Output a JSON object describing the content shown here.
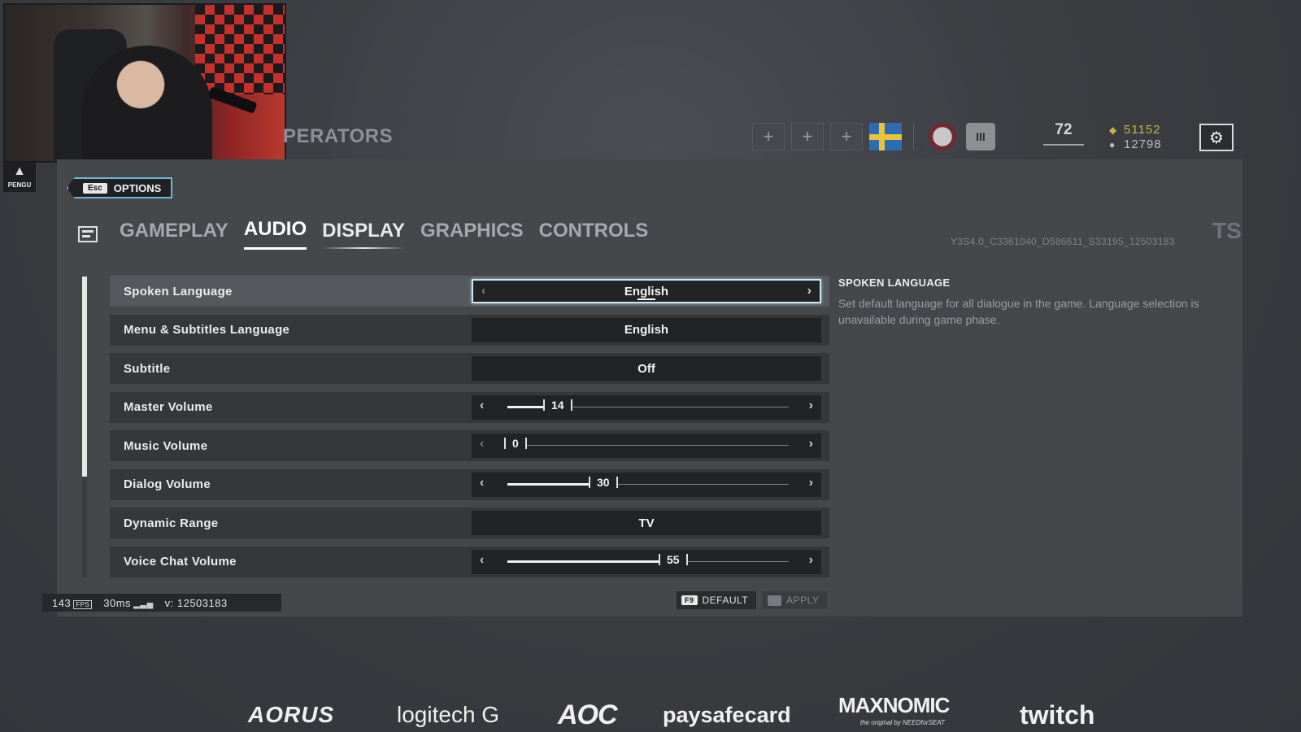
{
  "webcam": {
    "streamer_logo": "PENGU"
  },
  "header": {
    "partial_title": "PERATORS",
    "squad_slot_icon": "plus-icon",
    "level": "72",
    "renown": "51152",
    "credits": "12798",
    "settings_icon": "gear-icon"
  },
  "options": {
    "esc_key": "Esc",
    "label": "OPTIONS"
  },
  "tabs": [
    {
      "label": "GAMEPLAY"
    },
    {
      "label": "AUDIO"
    },
    {
      "label": "DISPLAY"
    },
    {
      "label": "GRAPHICS"
    },
    {
      "label": "CONTROLS"
    }
  ],
  "active_tab": "AUDIO",
  "ts_mark": "TS",
  "build_string": "Y3S4.0_C3361040_D586611_S33195_12503183",
  "settings": [
    {
      "label": "Spoken Language",
      "value": "English",
      "type": "select"
    },
    {
      "label": "Menu & Subtitles Language",
      "value": "English",
      "type": "select"
    },
    {
      "label": "Subtitle",
      "value": "Off",
      "type": "select"
    },
    {
      "label": "Master Volume",
      "value": "14",
      "type": "slider",
      "fill": 0.14
    },
    {
      "label": "Music Volume",
      "value": "0",
      "type": "slider",
      "fill": 0
    },
    {
      "label": "Dialog Volume",
      "value": "30",
      "type": "slider",
      "fill": 0.3
    },
    {
      "label": "Dynamic Range",
      "value": "TV",
      "type": "select"
    },
    {
      "label": "Voice Chat Volume",
      "value": "55",
      "type": "slider",
      "fill": 0.55
    }
  ],
  "description": {
    "title": "SPOKEN LANGUAGE",
    "text": "Set default language for all dialogue in the game. Language selection is unavailable during game phase."
  },
  "footer": {
    "default_key": "F9",
    "default_label": "DEFAULT",
    "apply_label": "APPLY"
  },
  "stats": {
    "fps": "143",
    "fps_label": "FPS",
    "ping": "30ms",
    "version": "v: 12503183"
  },
  "sponsors": {
    "aorus": "AORUS",
    "logitech": "logitech G",
    "aoc": "AOC",
    "paysafecard": "paysafecard",
    "maxnomic": "MAXNOMIC",
    "maxnomic_sub": "the original by NEEDforSEAT",
    "twitch": "twitch"
  },
  "colors": {
    "accent": "#6fb8d6",
    "renown": "#c9b445"
  }
}
